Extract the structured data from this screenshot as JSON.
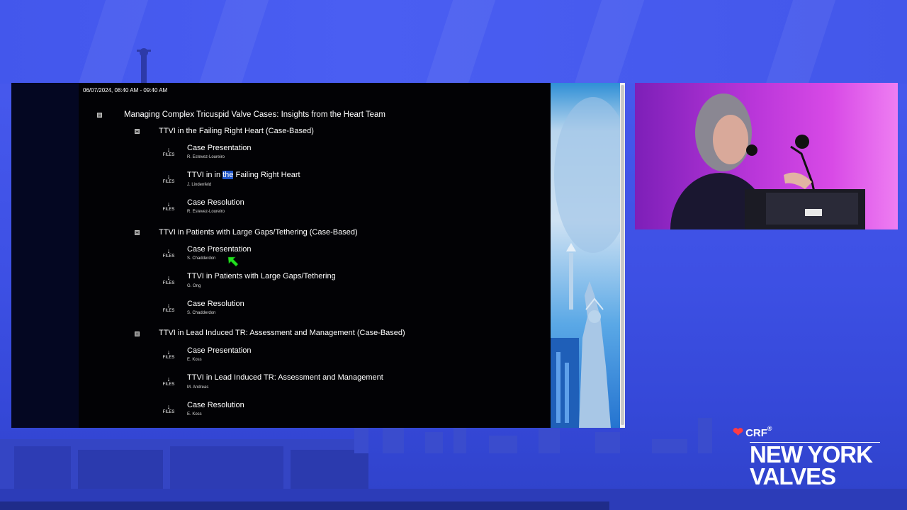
{
  "session": {
    "datetime": "06/07/2024, 08:40 AM - 09:40 AM",
    "title": "Managing Complex Tricuspid Valve Cases: Insights from the Heart Team"
  },
  "files_label": "FILES",
  "files_arrow": "↓",
  "sections": [
    {
      "title": "TTVI in the Failing Right Heart (Case-Based)",
      "items": [
        {
          "title": "Case Presentation",
          "author": "R. Estevez-Loureiro"
        },
        {
          "title_pre": "TTVI in in ",
          "title_hl": "the",
          "title_post": " Failing Right Heart",
          "author": "J. Lindenfeld"
        },
        {
          "title": "Case Resolution",
          "author": "R. Estevez-Loureiro"
        }
      ]
    },
    {
      "title": "TTVI in Patients with Large Gaps/Tethering (Case-Based)",
      "items": [
        {
          "title": "Case Presentation",
          "author": "S. Chadderdon"
        },
        {
          "title": "TTVI in Patients with Large Gaps/Tethering",
          "author": "G. Ong"
        },
        {
          "title": "Case Resolution",
          "author": "S. Chadderdon"
        }
      ]
    },
    {
      "title": "TTVI in Lead Induced TR: Assessment and Management (Case-Based)",
      "items": [
        {
          "title": "Case Presentation",
          "author": "E. Koss"
        },
        {
          "title": "TTVI in Lead Induced TR: Assessment and Management",
          "author": "M. Andreas"
        },
        {
          "title": "Case Resolution",
          "author": "E. Koss"
        }
      ]
    }
  ],
  "logo": {
    "brand": "CRF",
    "reg": "®",
    "line1": "NEW YORK",
    "line2": "VALVES"
  },
  "colors": {
    "background": "#3f52e6",
    "slide_bg": "#020205",
    "highlight": "#1f55c8",
    "cursor": "#22e01f",
    "heart": "#ff3b44"
  },
  "icons": [
    "collapse-square-icon",
    "download-arrow-icon",
    "cursor-arrow-icon",
    "heart-logo-icon"
  ]
}
